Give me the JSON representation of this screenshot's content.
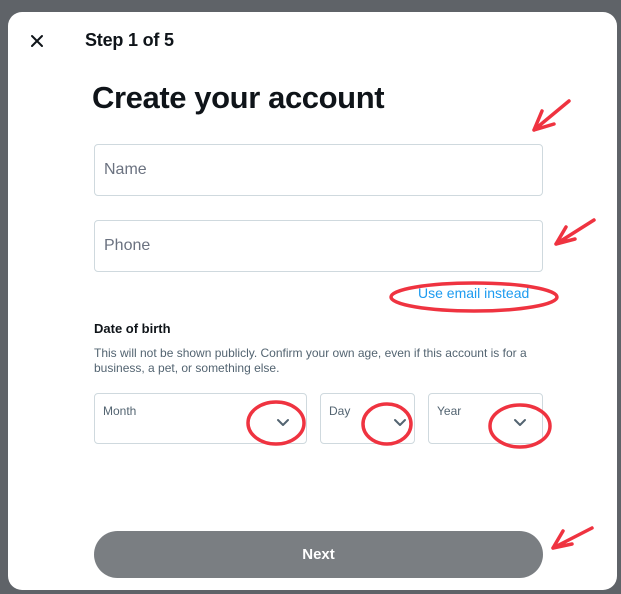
{
  "modal": {
    "step": "Step 1 of 5",
    "title": "Create your account",
    "fields": {
      "name": {
        "placeholder": "Name",
        "value": ""
      },
      "phone": {
        "placeholder": "Phone",
        "value": ""
      }
    },
    "link": {
      "use_email": "Use email instead"
    },
    "dob": {
      "title": "Date of birth",
      "help": "This will not be shown publicly. Confirm your own age, even if this account is for a business, a pet, or something else.",
      "month": {
        "label": "Month"
      },
      "day": {
        "label": "Day"
      },
      "year": {
        "label": "Year"
      }
    },
    "actions": {
      "next": "Next"
    }
  },
  "icons": {
    "close": "close-icon",
    "chevron": "chevron-down-icon",
    "annotation_arrow": "arrow-icon"
  },
  "colors": {
    "modal_background": "#ffffff",
    "text_primary": "#0f1419",
    "text_secondary": "#536471",
    "border": "#cfd9de",
    "link": "#1d9bf0",
    "button": "#7a7e82",
    "annotation": "#ef3340"
  }
}
